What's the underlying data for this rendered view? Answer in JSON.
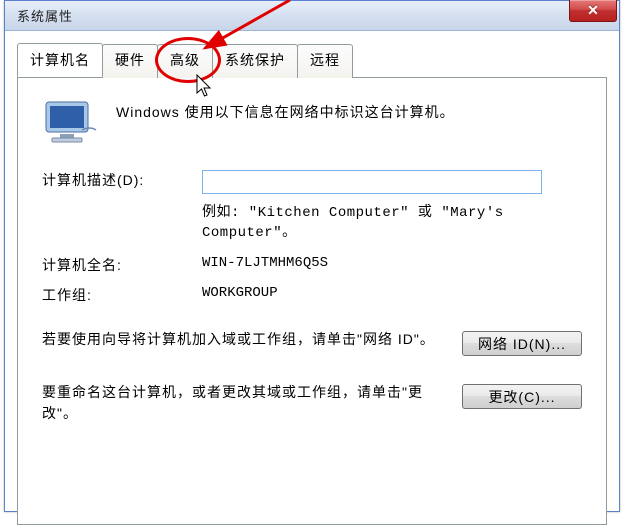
{
  "window": {
    "title": "系统属性",
    "close_label": "✕"
  },
  "tabs": {
    "computer_name": "计算机名",
    "hardware": "硬件",
    "advanced": "高级",
    "system_protection": "系统保护",
    "remote": "远程"
  },
  "panel": {
    "intro": "Windows 使用以下信息在网络中标识这台计算机。",
    "desc_label": "计算机描述(D):",
    "desc_value": "",
    "desc_example": "例如: \"Kitchen Computer\" 或 \"Mary's Computer\"。",
    "fullname_label": "计算机全名:",
    "fullname_value": "WIN-7LJTMHM6Q5S",
    "workgroup_label": "工作组:",
    "workgroup_value": "WORKGROUP",
    "netid_hint": "若要使用向导将计算机加入域或工作组，请单击\"网络 ID\"。",
    "netid_button": "网络 ID(N)...",
    "change_hint": "要重命名这台计算机，或者更改其域或工作组，请单击\"更改\"。",
    "change_button": "更改(C)..."
  },
  "annotation": {
    "highlight_tab": "advanced"
  }
}
